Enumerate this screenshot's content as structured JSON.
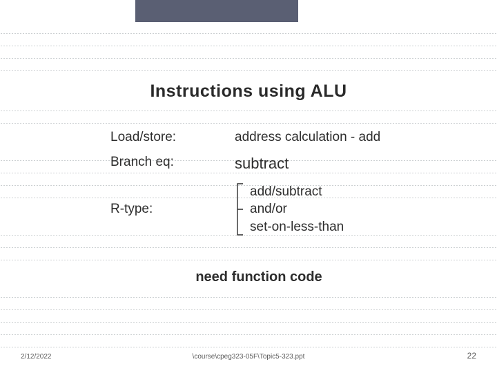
{
  "title": "Instructions using ALU",
  "rows": {
    "loadstore": {
      "label": "Load/store:",
      "value": "address calculation - add"
    },
    "branch": {
      "label": "Branch eq:",
      "value": "subtract"
    },
    "rtype": {
      "label": "R-type:",
      "lines": [
        "add/subtract",
        "and/or",
        "set-on-less-than"
      ]
    }
  },
  "need": "need function code",
  "footer": {
    "date": "2/12/2022",
    "path": "\\course\\cpeg323-05F\\Topic5-323.ppt",
    "page": "22"
  }
}
